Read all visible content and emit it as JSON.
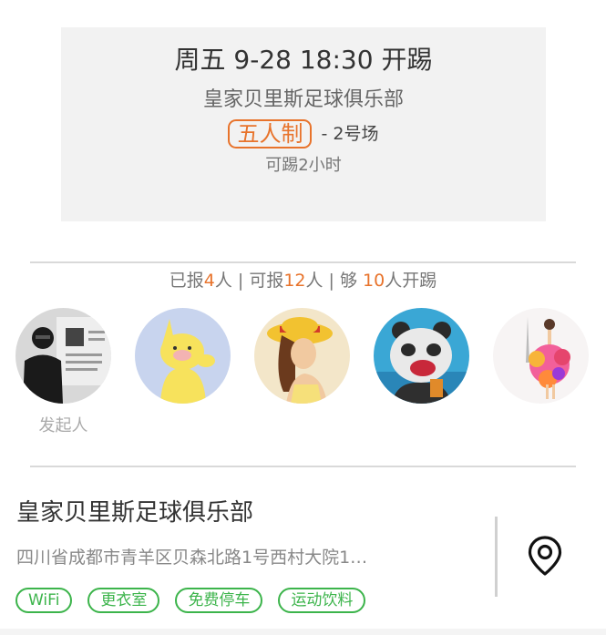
{
  "event": {
    "time": "周五 9-28 18:30 开踢",
    "club": "皇家贝里斯足球俱乐部",
    "format": "五人制",
    "court": "- 2号场",
    "duration": "可踢2小时"
  },
  "signup": {
    "prefix_joined": "已报",
    "joined_count": "4",
    "suffix_joined": "人 | 可报",
    "capacity": "12",
    "suffix_capacity": "人 | 够 ",
    "minimum": "10",
    "suffix_minimum": "人开踢"
  },
  "participants": {
    "organizer_label": "发起人",
    "avatars": [
      "avatar-organizer",
      "avatar-yellow-toy",
      "avatar-girl-straw-hat",
      "avatar-panda",
      "avatar-dress-illustration"
    ]
  },
  "venue": {
    "name": "皇家贝里斯足球俱乐部",
    "address": "四川省成都市青羊区贝森北路1号西村大院1…",
    "tags": [
      "WiFi",
      "更衣室",
      "免费停车",
      "运动饮料"
    ],
    "map_icon": "location-pin-icon"
  },
  "colors": {
    "accent_orange": "#e8732b",
    "tag_green": "#3cb44b",
    "card_bg": "#f2f2f2"
  }
}
